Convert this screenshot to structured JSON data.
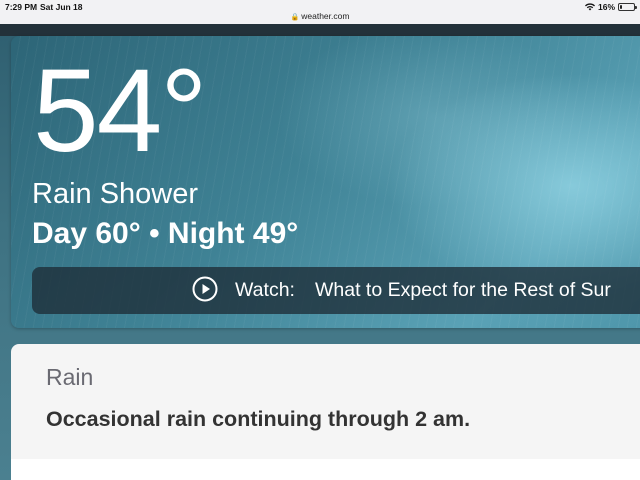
{
  "status_bar": {
    "time": "7:29 PM",
    "date": "Sat Jun 18",
    "battery_percent_label": "16%",
    "battery_level": 0.16
  },
  "browser": {
    "url": "weather.com"
  },
  "current": {
    "temperature": "54°",
    "phrase": "Rain Shower",
    "day_night": "Day 60° • Night 49°"
  },
  "video": {
    "label": "Watch:",
    "title": "What to Expect for the Rest of Sur"
  },
  "precip_card": {
    "title": "Rain",
    "description": "Occasional rain continuing through 2 am."
  },
  "colors": {
    "status_bar_bg": "#f2f2f4",
    "card_bg": "#f5f5f5",
    "hero_accent": "#3f8295"
  }
}
